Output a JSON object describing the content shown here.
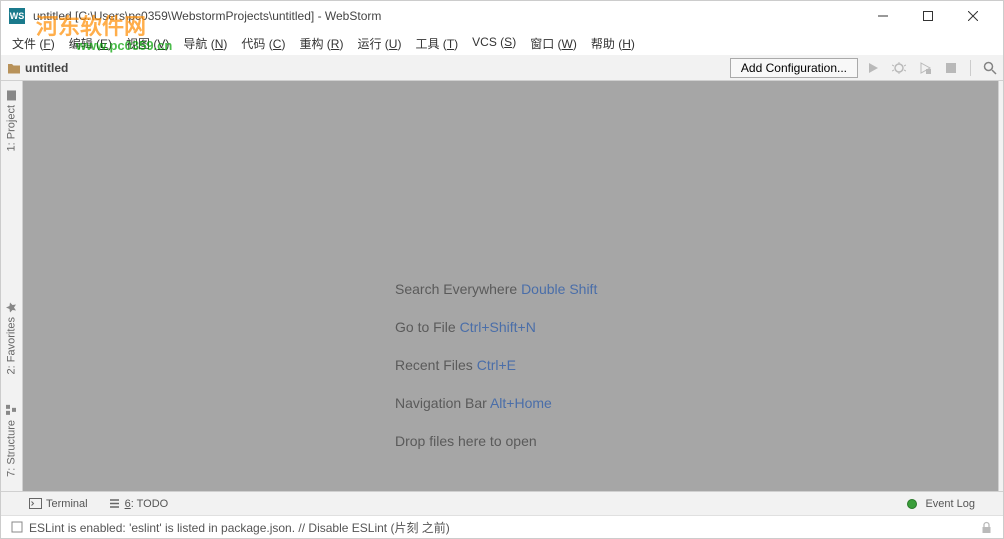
{
  "window": {
    "title": "untitled [C:\\Users\\pc0359\\WebstormProjects\\untitled] - WebStorm"
  },
  "watermark": {
    "text": "河东软件网",
    "url": "www.pc0359.cn"
  },
  "menu": {
    "items": [
      {
        "label": "文件",
        "mn": "F"
      },
      {
        "label": "编辑",
        "mn": "E"
      },
      {
        "label": "视图",
        "mn": "V"
      },
      {
        "label": "导航",
        "mn": "N"
      },
      {
        "label": "代码",
        "mn": "C"
      },
      {
        "label": "重构",
        "mn": "R"
      },
      {
        "label": "运行",
        "mn": "U"
      },
      {
        "label": "工具",
        "mn": "T"
      },
      {
        "label": "VCS",
        "mn": "S"
      },
      {
        "label": "窗口",
        "mn": "W"
      },
      {
        "label": "帮助",
        "mn": "H"
      }
    ]
  },
  "navbar": {
    "project": "untitled",
    "add_config": "Add Configuration..."
  },
  "gutters": {
    "project": "1: Project",
    "favorites": "2: Favorites",
    "structure": "7: Structure"
  },
  "hints": [
    {
      "label": "Search Everywhere",
      "shortcut": "Double Shift"
    },
    {
      "label": "Go to File",
      "shortcut": "Ctrl+Shift+N"
    },
    {
      "label": "Recent Files",
      "shortcut": "Ctrl+E"
    },
    {
      "label": "Navigation Bar",
      "shortcut": "Alt+Home"
    },
    {
      "label": "Drop files here to open",
      "shortcut": ""
    }
  ],
  "bottom": {
    "terminal": "Terminal",
    "todo_mn": "6",
    "todo": ": TODO",
    "event_log": "Event Log"
  },
  "status": {
    "message": "ESLint is enabled: 'eslint' is listed in package.json. // Disable ESLint (片刻 之前)"
  }
}
